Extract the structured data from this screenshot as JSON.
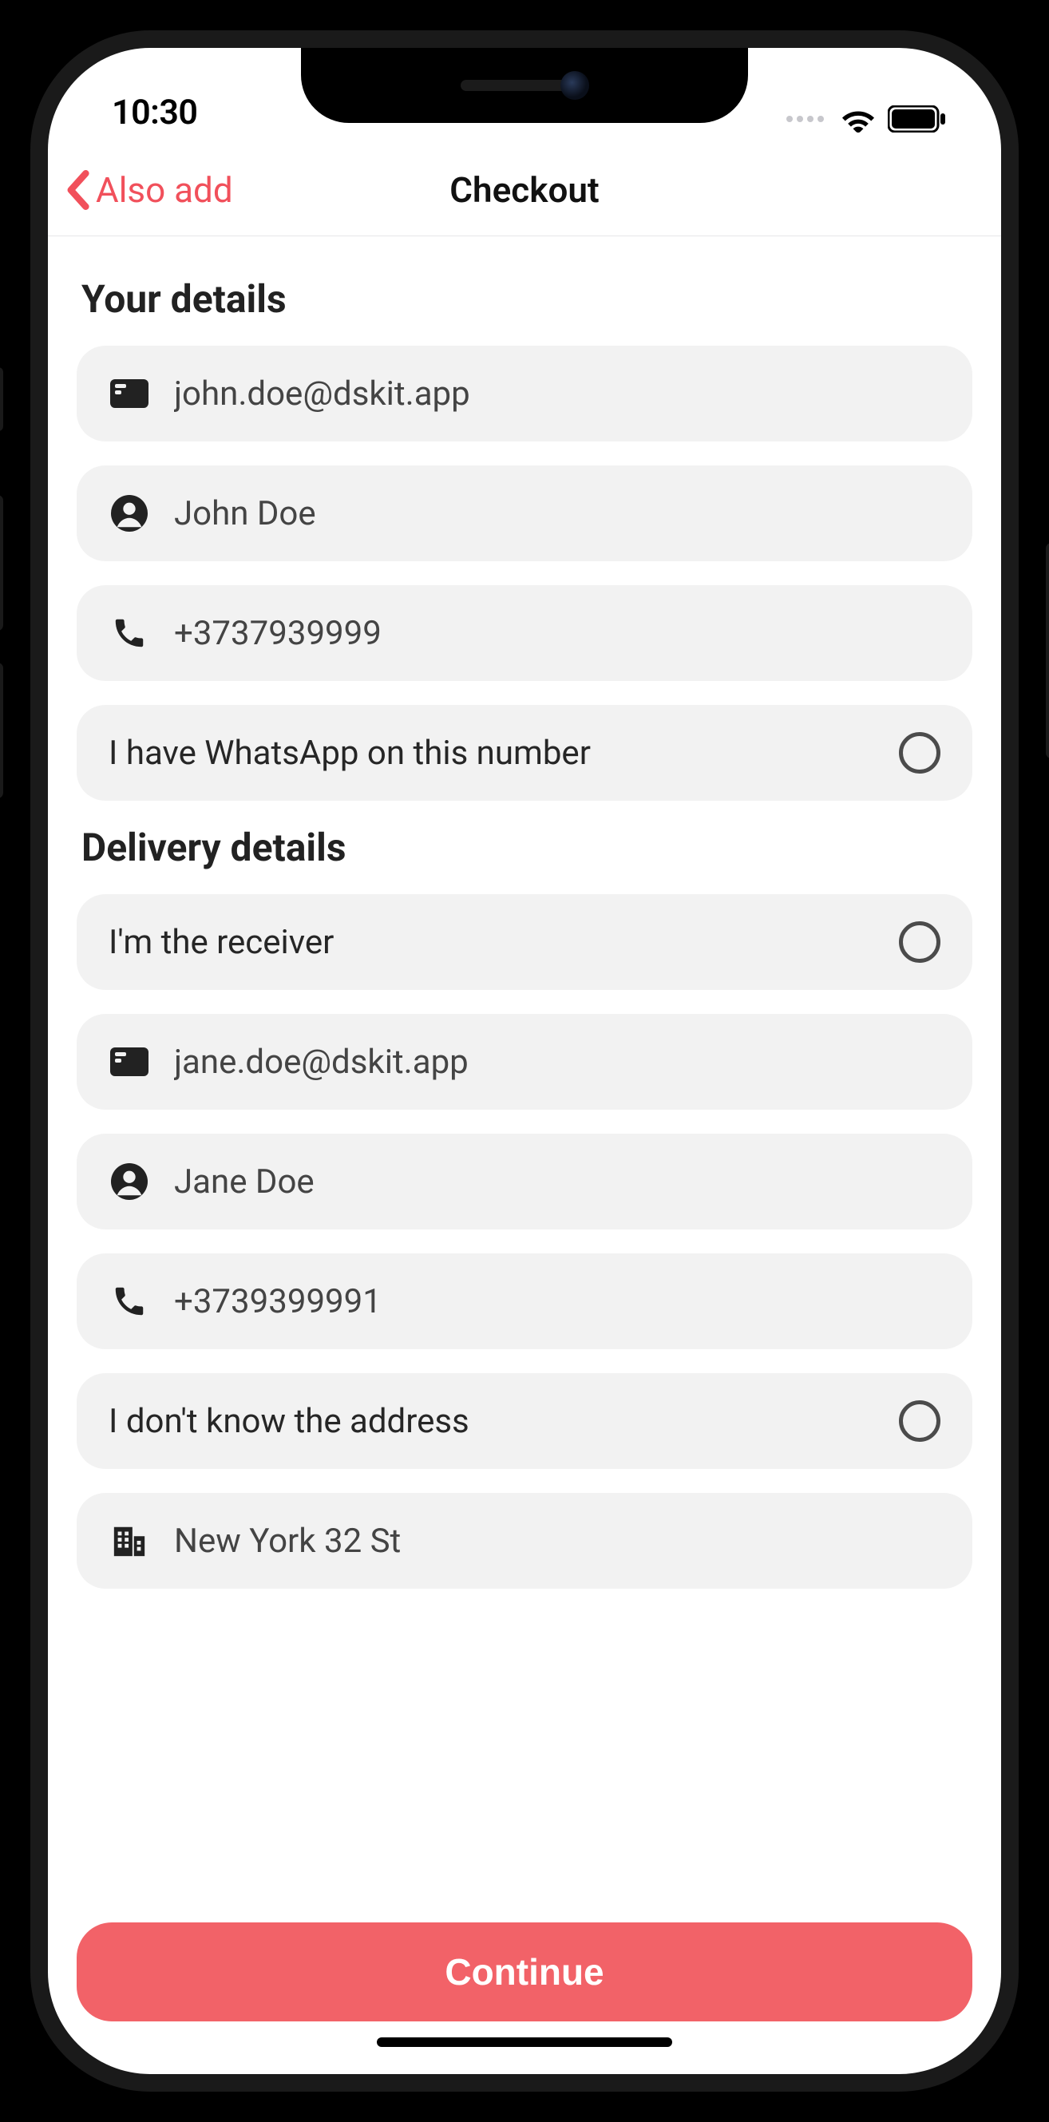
{
  "status": {
    "time": "10:30"
  },
  "nav": {
    "back_label": "Also add",
    "title": "Checkout"
  },
  "sections": {
    "your_details": {
      "title": "Your details",
      "email": "john.doe@dskit.app",
      "name": "John Doe",
      "phone": "+3737939999",
      "whatsapp_label": "I have WhatsApp on this number",
      "whatsapp_checked": false
    },
    "delivery_details": {
      "title": "Delivery details",
      "receiver_label": "I'm the receiver",
      "receiver_checked": false,
      "email": "jane.doe@dskit.app",
      "name": "Jane Doe",
      "phone": "+3739399991",
      "unknown_address_label": "I don't know the address",
      "unknown_address_checked": false,
      "address": "New York 32 St"
    }
  },
  "actions": {
    "continue_label": "Continue"
  },
  "colors": {
    "accent": "#f26268",
    "nav_accent": "#f1505b",
    "row_bg": "#f2f2f2"
  }
}
